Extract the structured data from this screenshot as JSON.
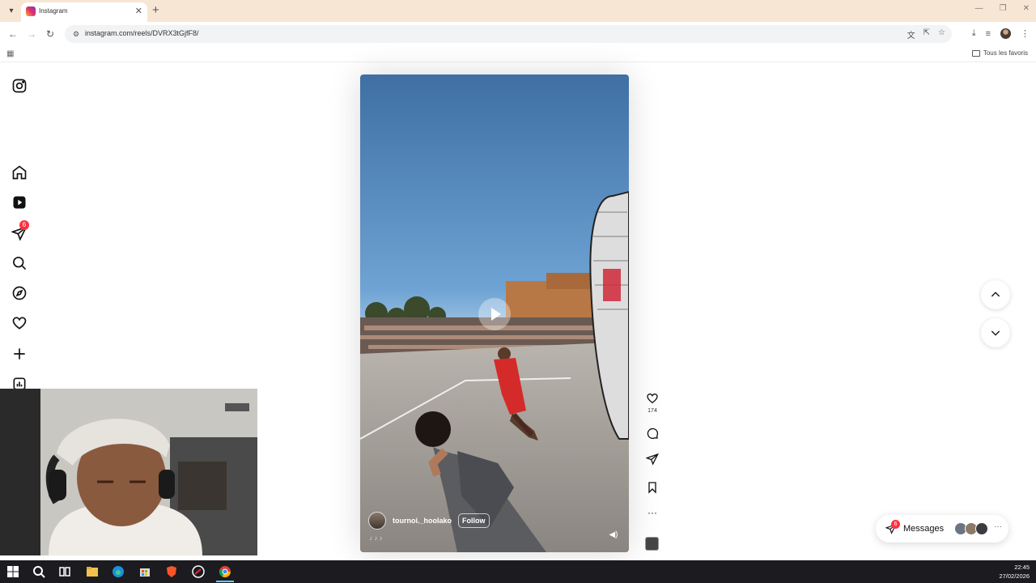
{
  "browser": {
    "tab_title": "Instagram",
    "url": "instagram.com/reels/DVRX3tGjfF8/",
    "bookmarks_folder": "Tous les favoris"
  },
  "sidebar": {
    "notifications_badge": "6",
    "items": [
      {
        "name": "instagram-logo-icon"
      },
      {
        "name": "home-icon"
      },
      {
        "name": "reels-icon"
      },
      {
        "name": "messages-icon"
      },
      {
        "name": "search-icon"
      },
      {
        "name": "explore-icon"
      },
      {
        "name": "heart-icon"
      },
      {
        "name": "create-icon"
      },
      {
        "name": "dashboard-icon"
      }
    ]
  },
  "reel": {
    "author": "tournoi._hoolako",
    "follow_label": "Follow",
    "caption": "♪ ♪ ♪",
    "like_count": "174"
  },
  "messages": {
    "label": "Messages",
    "badge": "6"
  },
  "taskbar": {
    "time": "22:45",
    "date": "27/02/2026"
  },
  "colors": {
    "tabstrip": "#f8e6d4",
    "badge": "#ff3040",
    "taskbar": "#1b1b20"
  }
}
